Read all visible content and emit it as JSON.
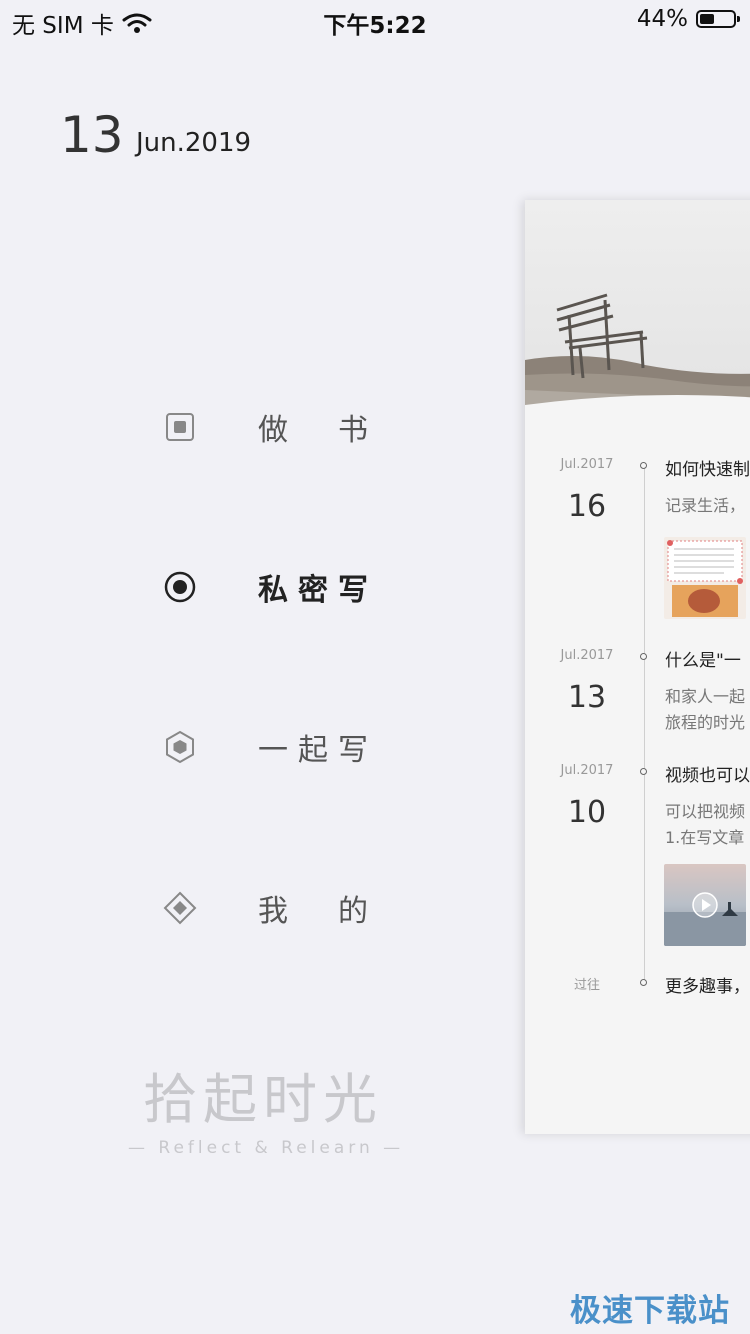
{
  "status_bar": {
    "carrier": "无 SIM 卡",
    "time": "下午5:22",
    "battery": "44%",
    "battery_level": 0.44
  },
  "header": {
    "day": "13",
    "month_year": "Jun.2019"
  },
  "menu": [
    {
      "label": "做　书",
      "icon": "square-dot-icon"
    },
    {
      "label": "私密写",
      "icon": "radio-dot-icon",
      "active": true
    },
    {
      "label": "一起写",
      "icon": "hexagon-icon"
    },
    {
      "label": "我　的",
      "icon": "diamond-icon"
    }
  ],
  "logo": {
    "cn": "拾起时光",
    "en": "— Reflect & Relearn —"
  },
  "timeline": [
    {
      "month": "Jul.2017",
      "day": "16",
      "title": "如何快速制",
      "body": [
        "记录生活，"
      ]
    },
    {
      "month": "Jul.2017",
      "day": "13",
      "title": "什么是\"一",
      "body": [
        "和家人一起",
        "旅程的时光"
      ]
    },
    {
      "month": "Jul.2017",
      "day": "10",
      "title": "视频也可以",
      "body": [
        "可以把视频",
        "1.在写文章"
      ]
    },
    {
      "month": "过往",
      "day": "",
      "title": "更多趣事，",
      "body": []
    }
  ],
  "watermark": "极速下载站"
}
